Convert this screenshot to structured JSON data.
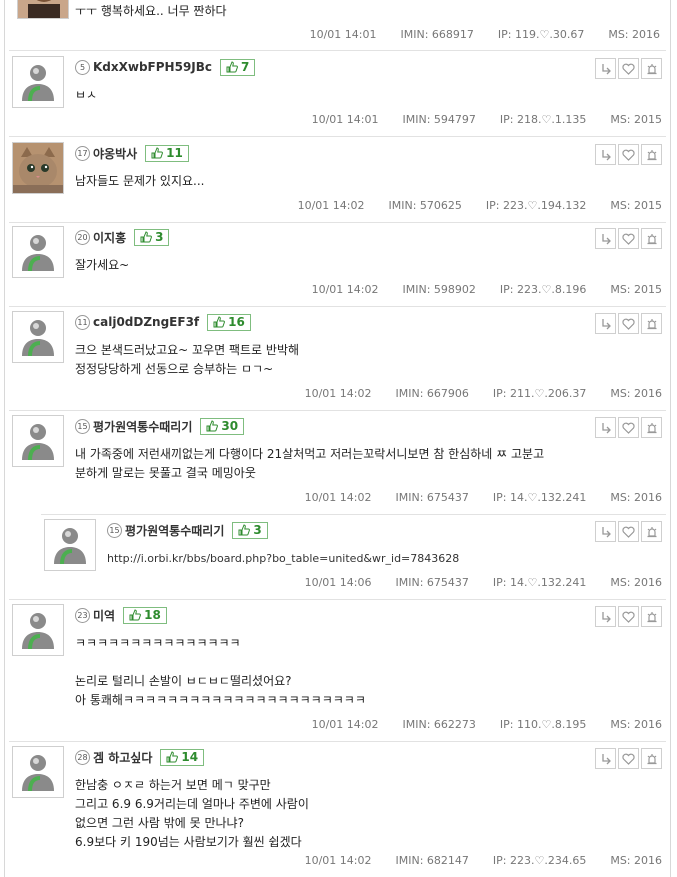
{
  "top_comment": {
    "text": "ㅜㅜ 행복하세요.. 너무 짠하다",
    "date": "10/01 14:01",
    "imin": "IMIN: 668917",
    "ip": "IP: 119.♡.30.67",
    "ms": "MS: 2016"
  },
  "comments": [
    {
      "level": "5",
      "nick": "KdxXwbFPH59JBc",
      "likes": "7",
      "lines": [
        "ㅂㅅ"
      ],
      "date": "10/01 14:01",
      "imin": "IMIN: 594797",
      "ip": "IP: 218.♡.1.135",
      "ms": "MS: 2015",
      "avatar": "default"
    },
    {
      "level": "17",
      "nick": "야옹박사",
      "likes": "11",
      "lines": [
        "남자들도 문제가 있지요..."
      ],
      "date": "10/01 14:02",
      "imin": "IMIN: 570625",
      "ip": "IP: 223.♡.194.132",
      "ms": "MS: 2015",
      "avatar": "cat"
    },
    {
      "level": "20",
      "nick": "이지홍",
      "likes": "3",
      "lines": [
        "잘가세요~"
      ],
      "date": "10/01 14:02",
      "imin": "IMIN: 598902",
      "ip": "IP: 223.♡.8.196",
      "ms": "MS: 2015",
      "avatar": "default"
    },
    {
      "level": "11",
      "nick": "calj0dDZngEF3f",
      "likes": "16",
      "lines": [
        "크으 본색드러났고요~ 꼬우면 팩트로 반박해",
        "정정당당하게 선동으로 승부하는 ㅁㄱ~"
      ],
      "date": "10/01 14:02",
      "imin": "IMIN: 667906",
      "ip": "IP: 211.♡.206.37",
      "ms": "MS: 2016",
      "avatar": "default"
    },
    {
      "level": "15",
      "nick": "평가원역통수때리기",
      "likes": "30",
      "lines": [
        "내 가족중에 저런새끼없는게 다행이다 21살처먹고 저러는꼬락서니보면 참 한심하네 ㅉ 고분고",
        "분하게 말로는 못풀고 결국 메밍아웃"
      ],
      "date": "10/01 14:02",
      "imin": "IMIN: 675437",
      "ip": "IP: 14.♡.132.241",
      "ms": "MS: 2016",
      "avatar": "default"
    },
    {
      "level": "15",
      "nick": "평가원역통수때리기",
      "likes": "3",
      "lines": [
        "http://i.orbi.kr/bbs/board.php?bo_table=united&wr_id=7843628"
      ],
      "date": "10/01 14:06",
      "imin": "IMIN: 675437",
      "ip": "IP: 14.♡.132.241",
      "ms": "MS: 2016",
      "avatar": "default",
      "reply": true
    },
    {
      "level": "23",
      "nick": "미역",
      "likes": "18",
      "lines": [
        "ㅋㅋㅋㅋㅋㅋㅋㅋㅋㅋㅋㅋㅋㅋㅋ",
        "",
        "논리로 털리니 손발이 ㅂㄷㅂㄷ떨리셨어요?",
        "아 통쾌해ㅋㅋㅋㅋㅋㅋㅋㅋㅋㅋㅋㅋㅋㅋㅋㅋㅋㅋㅋㅋㅋㅋ"
      ],
      "date": "10/01 14:02",
      "imin": "IMIN: 662273",
      "ip": "IP: 110.♡.8.195",
      "ms": "MS: 2016",
      "avatar": "default"
    },
    {
      "level": "28",
      "nick": "겜 하고싶다",
      "likes": "14",
      "lines": [
        "한남충 ㅇㅈㄹ 하는거 보면 메ㄱ 맞구만",
        "그리고 6.9 6.9거리는데 얼마나 주변에 사람이",
        "없으면 그런 사람 밖에 못 만나냐?",
        "6.9보다 키 190넘는 사람보기가 훨씬 쉽겠다"
      ],
      "date": "10/01 14:02",
      "imin": "IMIN: 682147",
      "ip": "IP: 223.♡.234.65",
      "ms": "MS: 2016",
      "avatar": "default"
    }
  ],
  "icons": {
    "reply": "reply-arrow-icon",
    "like": "heart-icon",
    "report": "siren-icon",
    "thumb": "thumbs-up-icon"
  },
  "colors": {
    "like_border": "#7fbd7f",
    "like_text": "#2e8b2e",
    "meta": "#777777",
    "separator": "#e2e2e2"
  }
}
